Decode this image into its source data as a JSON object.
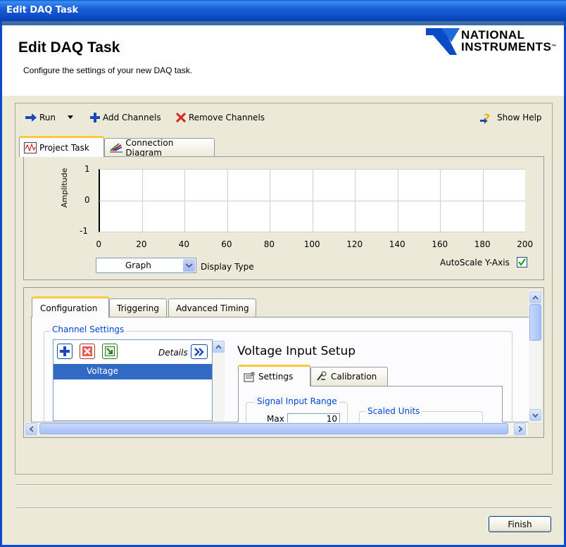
{
  "window": {
    "title": "Edit DAQ Task"
  },
  "header": {
    "title": "Edit DAQ Task",
    "subtitle": "Configure the settings of your new DAQ task.",
    "logo_line1": "NATIONAL",
    "logo_line2": "INSTRUMENTS",
    "logo_tm": "™"
  },
  "toolbar": {
    "run_label": "Run",
    "add_label": "Add Channels",
    "remove_label": "Remove Channels",
    "help_label": "Show Help"
  },
  "top_tabs": [
    {
      "label": "Project Task",
      "active": true
    },
    {
      "label": "Connection Diagram",
      "active": false
    }
  ],
  "graph": {
    "ylabel": "Amplitude",
    "yticks": [
      "1",
      "0",
      "-1"
    ],
    "xticks": [
      "0",
      "20",
      "40",
      "60",
      "80",
      "100",
      "120",
      "140",
      "160",
      "180",
      "200"
    ],
    "ylim": [
      -1,
      1
    ],
    "xlim": [
      0,
      200
    ],
    "display_type_value": "Graph",
    "display_type_label": "Display Type",
    "autoscale_label": "AutoScale Y-Axis",
    "autoscale_checked": true
  },
  "config_tabs": [
    {
      "label": "Configuration",
      "active": true
    },
    {
      "label": "Triggering",
      "active": false
    },
    {
      "label": "Advanced Timing",
      "active": false
    }
  ],
  "channel_settings": {
    "legend": "Channel Settings",
    "details_label": "Details",
    "channels": [
      "Voltage"
    ]
  },
  "voltage_setup": {
    "title": "Voltage Input Setup",
    "tabs": [
      {
        "label": "Settings",
        "active": true
      },
      {
        "label": "Calibration",
        "active": false
      }
    ],
    "signal_range_legend": "Signal Input Range",
    "max_label": "Max",
    "max_value": "10",
    "scaled_units_legend": "Scaled Units"
  },
  "footer": {
    "finish_label": "Finish"
  },
  "colors": {
    "titlebar": "#0a4bc8",
    "selection": "#316ac5",
    "legend_text": "#0046d5",
    "active_tab_accent": "#ffc83c"
  }
}
